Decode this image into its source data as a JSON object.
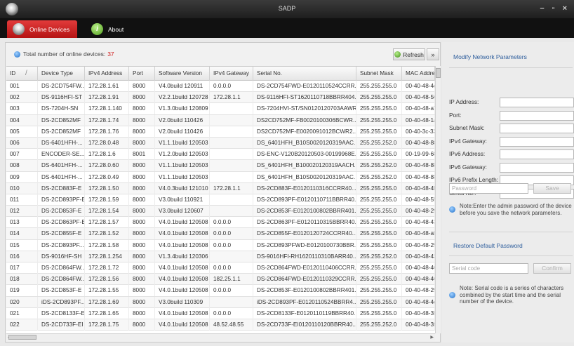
{
  "window": {
    "title": "SADP",
    "controls": "– ▫ ×"
  },
  "tabs": [
    {
      "label": "Online Devices"
    },
    {
      "label": "About",
      "icon_glyph": "i"
    }
  ],
  "toolbar": {
    "total_label": "Total number of online devices:",
    "total_count": "37",
    "refresh_label": "Refresh",
    "expand_label": "»"
  },
  "table": {
    "columns": [
      "ID",
      "Device Type",
      "IPv4 Address",
      "Port",
      "Software Version",
      "IPv4 Gateway",
      "Serial No.",
      "Subnet Mask",
      "MAC Address"
    ],
    "rows": [
      [
        "001",
        "DS-2CD754FW...",
        "172.28.1.61",
        "8000",
        "V4.0build 120911",
        "0.0.0.0",
        "DS-2CD754FWD-E0120110524CCRR...",
        "255.255.255.0",
        "00-40-48-4d-"
      ],
      [
        "002",
        "DS-9116HFI-ST",
        "172.28.1.91",
        "8000",
        "V2.2.1build 120728",
        "172.28.1.1",
        "DS-9116HFI-ST1620110718BBRR404...",
        "255.255.255.0",
        "00-40-48-56-"
      ],
      [
        "003",
        "DS-7204H-SN",
        "172.28.1.140",
        "8000",
        "V1.3.0build 120809",
        "",
        "DS-7204HVI-ST/SN0120120703AAWR...",
        "255.255.255.0",
        "00-40-48-a7-"
      ],
      [
        "004",
        "DS-2CD852MF",
        "172.28.1.74",
        "8000",
        "V2.0build 110426",
        "",
        "DS2CD752MF-FB0020100306BCWR...",
        "255.255.255.0",
        "00-40-48-1a-"
      ],
      [
        "005",
        "DS-2CD852MF",
        "172.28.1.76",
        "8000",
        "V2.0build 110426",
        "",
        "DS2CD752MF-E0020091012BCWR2...",
        "255.255.255.0",
        "00-40-3c-33-"
      ],
      [
        "006",
        "DS-6401HFH-...",
        "172.28.0.48",
        "8000",
        "V1.1.1build 120503",
        "",
        "DS_6401HFH_B10S0020120319AAC...",
        "255.255.252.0",
        "00-40-48-88-"
      ],
      [
        "007",
        "ENCODER-SE...",
        "172.28.1.6",
        "8001",
        "V1.2.0build 120503",
        "",
        "DS-ENC-V120B20120503-00199968E...",
        "255.255.255.0",
        "00-19-99-68-"
      ],
      [
        "008",
        "DS-6401HFH-...",
        "172.28.0.60",
        "8000",
        "V1.1.1build 120503",
        "",
        "DS_6401HFH_B100020120319AACH...",
        "255.255.252.0",
        "00-40-48-88-"
      ],
      [
        "009",
        "DS-6401HFH-...",
        "172.28.0.49",
        "8000",
        "V1.1.1build 120503",
        "",
        "DS_6401HFH_B10S0020120319AAC...",
        "255.255.252.0",
        "00-40-48-88-"
      ],
      [
        "010",
        "DS-2CD883F-E",
        "172.28.1.50",
        "8000",
        "V4.0.3build 121010",
        "172.28.1.1",
        "DS-2CD883F-E0120110316CCRR40...",
        "255.255.255.0",
        "00-40-48-4b-"
      ],
      [
        "011",
        "DS-2CD893PF-E",
        "172.28.1.59",
        "8000",
        "V3.0build 110921",
        "",
        "DS-2CD893PF-E0120110711BBRR40...",
        "255.255.255.0",
        "00-40-48-55-"
      ],
      [
        "012",
        "DS-2CD853F-E",
        "172.28.1.54",
        "8000",
        "V3.0build 120607",
        "",
        "DS-2CD853F-E0120100802BBRR401...",
        "255.255.255.0",
        "00-40-48-29-"
      ],
      [
        "013",
        "DS-2CD863PF-E",
        "172.28.1.57",
        "8000",
        "V4.0.1build 120508",
        "0.0.0.0",
        "DS-2CD863PF-E0120110315BBRR40...",
        "255.255.255.0",
        "00-40-48-43-"
      ],
      [
        "014",
        "DS-2CD855F-E",
        "172.28.1.52",
        "8000",
        "V4.0.1build 120508",
        "0.0.0.0",
        "DS-2CD855F-E0120120724CCRR40...",
        "255.255.255.0",
        "00-40-48-af-"
      ],
      [
        "015",
        "DS-2CD893PF...",
        "172.28.1.58",
        "8000",
        "V4.0.1build 120508",
        "0.0.0.0",
        "DS-2CD893PFWD-E0120100730BBR...",
        "255.255.255.0",
        "00-40-48-29-"
      ],
      [
        "016",
        "DS-9016HF-SH",
        "172.28.1.254",
        "8000",
        "V1.3.4build 120306",
        "",
        "DS-9016HFI-RH1620110310BARR40...",
        "255.255.252.0",
        "00-40-48-43-"
      ],
      [
        "017",
        "DS-2CD864FW...",
        "172.28.1.72",
        "8000",
        "V4.0.1build 120508",
        "0.0.0.0",
        "DS-2CD864FWD-E0120110406CCRR...",
        "255.255.255.0",
        "00-40-48-46-"
      ],
      [
        "018",
        "DS-2CD864FW...",
        "172.28.1.56",
        "8000",
        "V4.0.1build 120508",
        "182.25.1.1",
        "DS-2CD864FWD-E0120110329CCRR...",
        "255.255.255.0",
        "00-40-48-46-"
      ],
      [
        "019",
        "DS-2CD853F-E",
        "172.28.1.55",
        "8000",
        "V4.0.1build 120508",
        "0.0.0.0",
        "DS-2CD853F-E0120100802BBRR401...",
        "255.255.255.0",
        "00-40-48-29-"
      ],
      [
        "020",
        "iDS-2CD893PF...",
        "172.28.1.69",
        "8000",
        "V3.0build 110309",
        "",
        "iDS-2CD893PF-E0120110524BBRR4...",
        "255.255.255.0",
        "00-40-48-4d-"
      ],
      [
        "021",
        "DS-2CD8133F-E",
        "172.28.1.65",
        "8000",
        "V4.0.1build 120508",
        "0.0.0.0",
        "DS-2CD8133F-E0120110119BBRR40...",
        "255.255.255.0",
        "00-40-48-3f-"
      ],
      [
        "022",
        "DS-2CD733F-EI",
        "172.28.1.75",
        "8000",
        "V4.0.1build 120508",
        "48.52.48.55",
        "DS-2CD733F-EI0120110120BBRR40...",
        "255.255.252.0",
        "00-40-48-3f-"
      ]
    ]
  },
  "modify_panel": {
    "title": "Modify Network Parameters",
    "fields": [
      "IP Address:",
      "Port:",
      "Subnet Mask:",
      "IPv4 Gateway:",
      "IPv6 Address:",
      "IPv6 Gateway:",
      "IPv6 Prefix Length:",
      "Serial No.:"
    ],
    "password_placeholder": "Password",
    "save_label": "Save",
    "note": "Note:Enter the admin password of the device before you save the network parameters."
  },
  "restore_panel": {
    "title": "Restore Default Password",
    "serial_placeholder": "Serial code",
    "confirm_label": "Confirm",
    "note": "Note: Serial code is a series of characters combined by the start time and the serial number of the device."
  }
}
